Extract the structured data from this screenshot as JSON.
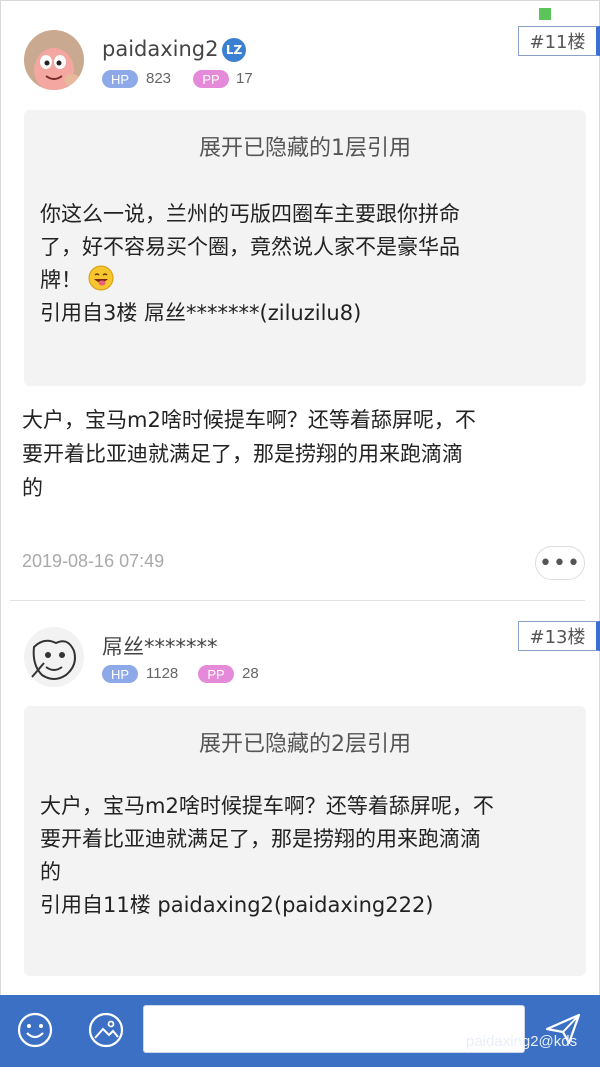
{
  "posts": [
    {
      "username": "paidaxing2",
      "lz_badge": "LZ",
      "hp_label": "HP",
      "hp_value": "823",
      "pp_label": "PP",
      "pp_value": "17",
      "floor": "#11楼",
      "quote": {
        "expand_label": "展开已隐藏的1层引用",
        "lines": [
          "你这么一说，兰州的丐版四圈车主要跟你拼命",
          "了，好不容易买个圈，竟然说人家不是豪华品",
          "牌！"
        ],
        "emoji_icon": "grinning-tongue-emoji",
        "source": "引用自3楼 屌丝*******(ziluzilu8)"
      },
      "body_lines": [
        "大户，宝马m2啥时候提车啊？还等着舔屏呢，不",
        "要开着比亚迪就满足了，那是捞翔的用来跑滴滴",
        "的"
      ],
      "timestamp": "2019-08-16 07:49",
      "more_label": "•••"
    },
    {
      "username": "屌丝*******",
      "hp_label": "HP",
      "hp_value": "1128",
      "pp_label": "PP",
      "pp_value": "28",
      "floor": "#13楼",
      "quote": {
        "expand_label": "展开已隐藏的2层引用",
        "lines": [
          "大户，宝马m2啥时候提车啊？还等着舔屏呢，不",
          "要开着比亚迪就满足了，那是捞翔的用来跑滴滴",
          "的"
        ],
        "source": "引用自11楼 paidaxing2(paidaxing222)"
      }
    }
  ],
  "bottom_bar": {
    "emoji_icon": "smiley-face-icon",
    "image_icon": "image-picker-icon",
    "send_icon": "send-paper-plane-icon",
    "input_value": ""
  },
  "watermark": "paidaxing2@kds",
  "colors": {
    "accent": "#3b70c4",
    "hp": "#8ea9e8",
    "pp": "#e58ad8",
    "quote_bg": "#f3f3f3"
  }
}
